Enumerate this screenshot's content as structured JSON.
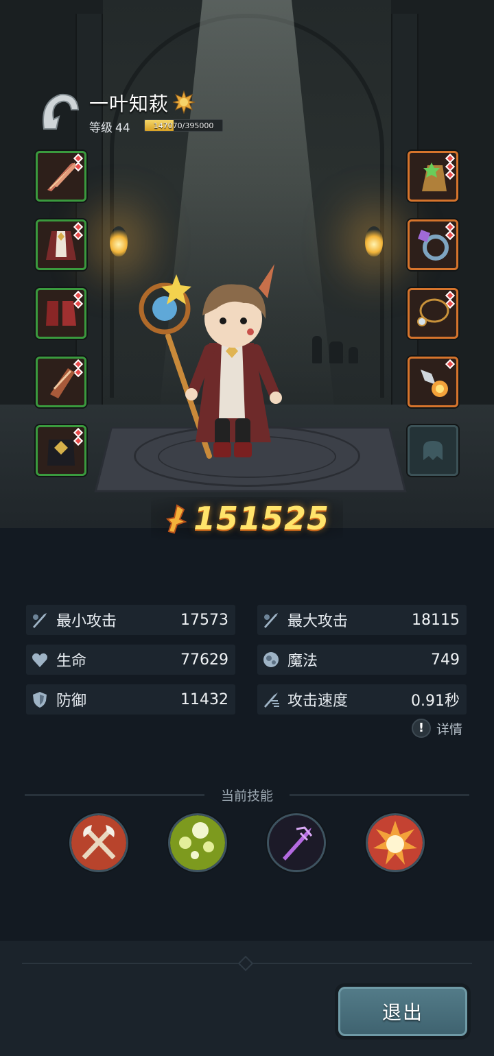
{
  "player": {
    "name": "一叶知萩",
    "level_label": "等级",
    "level": "44",
    "xp_text": "147070/395000",
    "xp_current": 147070,
    "xp_max": 395000
  },
  "equipment": {
    "left": [
      "feather-blade-icon",
      "robe-icon",
      "boots-icon",
      "bracer-icon",
      "helmet-icon"
    ],
    "right": [
      "gold-charm-icon",
      "ring-icon",
      "necklace-icon",
      "fire-rocket-icon"
    ],
    "empty_slot": "locked-slot-icon"
  },
  "combat_power": "151525",
  "stats": {
    "min_attack": {
      "label": "最小攻击",
      "value": "17573"
    },
    "max_attack": {
      "label": "最大攻击",
      "value": "18115"
    },
    "hp": {
      "label": "生命",
      "value": "77629"
    },
    "mana": {
      "label": "魔法",
      "value": "749"
    },
    "defense": {
      "label": "防御",
      "value": "11432"
    },
    "attack_speed": {
      "label": "攻击速度",
      "value": "0.91秒"
    }
  },
  "details_label": "详情",
  "skills": {
    "title": "当前技能",
    "icons": [
      "crossed-axes-icon",
      "green-orbs-icon",
      "purple-sword-icon",
      "explosion-icon"
    ]
  },
  "exit_label": "退出",
  "colors": {
    "power": "#ffe46b",
    "slot_green": "#3a9a3e",
    "slot_orange": "#d6742c",
    "xp_fill": "#d9a226",
    "exit_button": "#4a6f7b"
  }
}
